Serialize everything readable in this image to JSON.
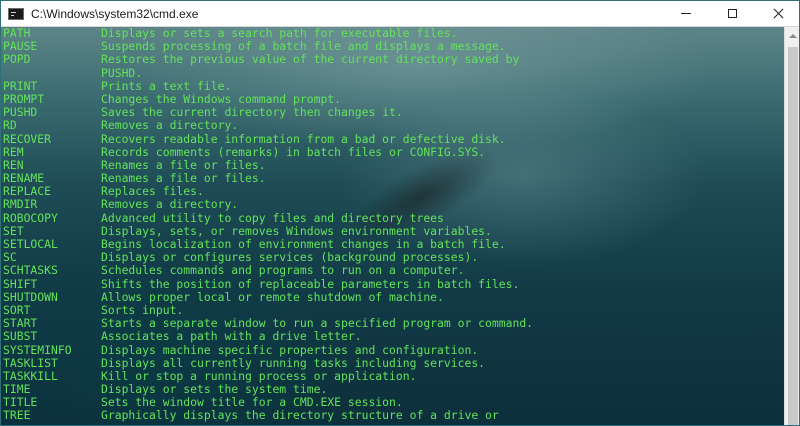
{
  "window": {
    "title": "C:\\Windows\\system32\\cmd.exe",
    "app_icon": "console-icon"
  },
  "colors": {
    "text": "#63e35a",
    "titlebar": "#ffffff"
  },
  "console": {
    "lines": [
      {
        "cmd": "PATH",
        "desc": "Displays or sets a search path for executable files."
      },
      {
        "cmd": "PAUSE",
        "desc": "Suspends processing of a batch file and displays a message."
      },
      {
        "cmd": "POPD",
        "desc": "Restores the previous value of the current directory saved by"
      },
      {
        "cmd": "",
        "desc": "PUSHD."
      },
      {
        "cmd": "PRINT",
        "desc": "Prints a text file."
      },
      {
        "cmd": "PROMPT",
        "desc": "Changes the Windows command prompt."
      },
      {
        "cmd": "PUSHD",
        "desc": "Saves the current directory then changes it."
      },
      {
        "cmd": "RD",
        "desc": "Removes a directory."
      },
      {
        "cmd": "RECOVER",
        "desc": "Recovers readable information from a bad or defective disk."
      },
      {
        "cmd": "REM",
        "desc": "Records comments (remarks) in batch files or CONFIG.SYS."
      },
      {
        "cmd": "REN",
        "desc": "Renames a file or files."
      },
      {
        "cmd": "RENAME",
        "desc": "Renames a file or files."
      },
      {
        "cmd": "REPLACE",
        "desc": "Replaces files."
      },
      {
        "cmd": "RMDIR",
        "desc": "Removes a directory."
      },
      {
        "cmd": "ROBOCOPY",
        "desc": "Advanced utility to copy files and directory trees"
      },
      {
        "cmd": "SET",
        "desc": "Displays, sets, or removes Windows environment variables."
      },
      {
        "cmd": "SETLOCAL",
        "desc": "Begins localization of environment changes in a batch file."
      },
      {
        "cmd": "SC",
        "desc": "Displays or configures services (background processes)."
      },
      {
        "cmd": "SCHTASKS",
        "desc": "Schedules commands and programs to run on a computer."
      },
      {
        "cmd": "SHIFT",
        "desc": "Shifts the position of replaceable parameters in batch files."
      },
      {
        "cmd": "SHUTDOWN",
        "desc": "Allows proper local or remote shutdown of machine."
      },
      {
        "cmd": "SORT",
        "desc": "Sorts input."
      },
      {
        "cmd": "START",
        "desc": "Starts a separate window to run a specified program or command."
      },
      {
        "cmd": "SUBST",
        "desc": "Associates a path with a drive letter."
      },
      {
        "cmd": "SYSTEMINFO",
        "desc": "Displays machine specific properties and configuration."
      },
      {
        "cmd": "TASKLIST",
        "desc": "Displays all currently running tasks including services."
      },
      {
        "cmd": "TASKKILL",
        "desc": "Kill or stop a running process or application."
      },
      {
        "cmd": "TIME",
        "desc": "Displays or sets the system time."
      },
      {
        "cmd": "TITLE",
        "desc": "Sets the window title for a CMD.EXE session."
      },
      {
        "cmd": "TREE",
        "desc": "Graphically displays the directory structure of a drive or"
      }
    ]
  }
}
